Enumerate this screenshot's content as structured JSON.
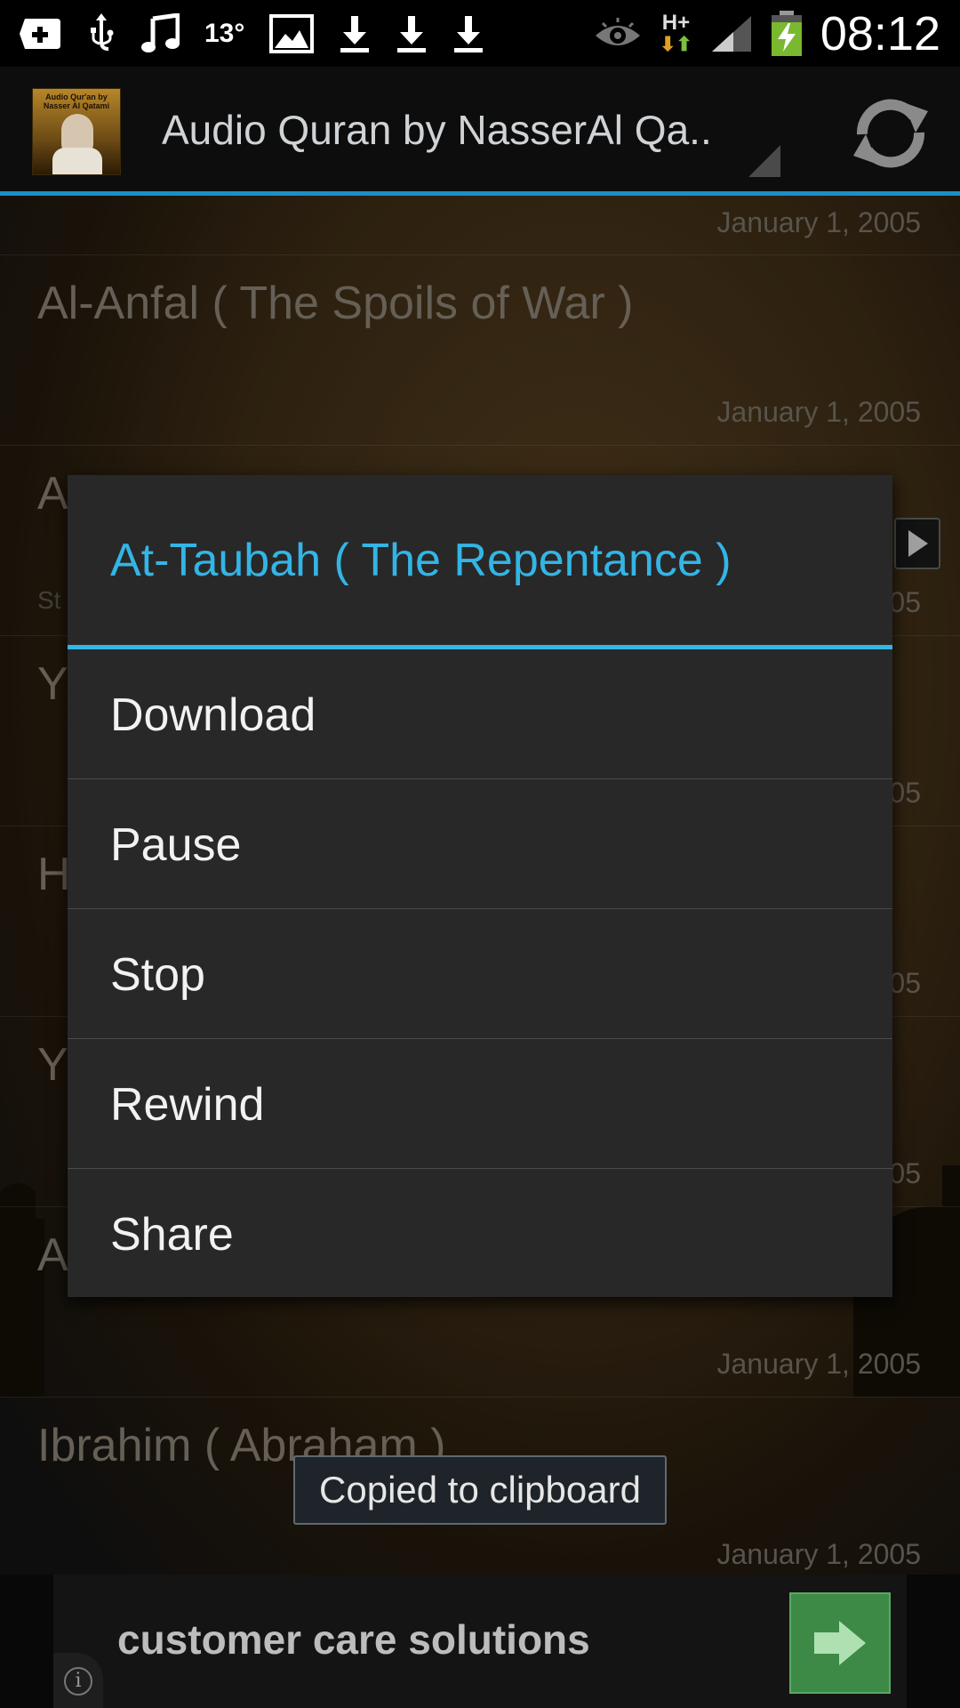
{
  "status_bar": {
    "temperature": "13°",
    "time": "08:12",
    "network": "H+",
    "icons": [
      "add-icon",
      "usb-icon",
      "music-icon",
      "temperature",
      "image-icon",
      "download-icon",
      "download-icon",
      "download-icon",
      "eye-icon",
      "network-icon",
      "signal-icon",
      "battery-icon"
    ]
  },
  "action_bar": {
    "title": "Audio Quran by NasserAl Qa..",
    "icon_caption": "Audio Qur'an by Nasser Al Qatami",
    "refresh_icon": "refresh-icon"
  },
  "list": {
    "rows": [
      {
        "title": "",
        "date": "January 1, 2005"
      },
      {
        "title": "Al-Anfal ( The Spoils of War )",
        "date": "January 1, 2005"
      },
      {
        "title": "A",
        "sub": "St",
        "date": "05"
      },
      {
        "title": "Y",
        "date": "05"
      },
      {
        "title": "H",
        "date": "05"
      },
      {
        "title": "Y",
        "date": "05"
      },
      {
        "title": "A",
        "date": "January 1, 2005"
      },
      {
        "title": "Ibrahim ( Abraham )",
        "date": "January 1, 2005"
      }
    ]
  },
  "dialog": {
    "title": "At-Taubah ( The Repentance )",
    "items": [
      "Download",
      "Pause",
      "Stop",
      "Rewind",
      "Share"
    ]
  },
  "toast": "Copied to clipboard",
  "ad": {
    "text": "customer care solutions",
    "button_icon": "arrow-right-icon",
    "info_icon": "info-icon"
  },
  "colors": {
    "accent": "#33b5e5",
    "actionbar_divider": "#1b8fc6",
    "dialog_bg": "#282828"
  }
}
